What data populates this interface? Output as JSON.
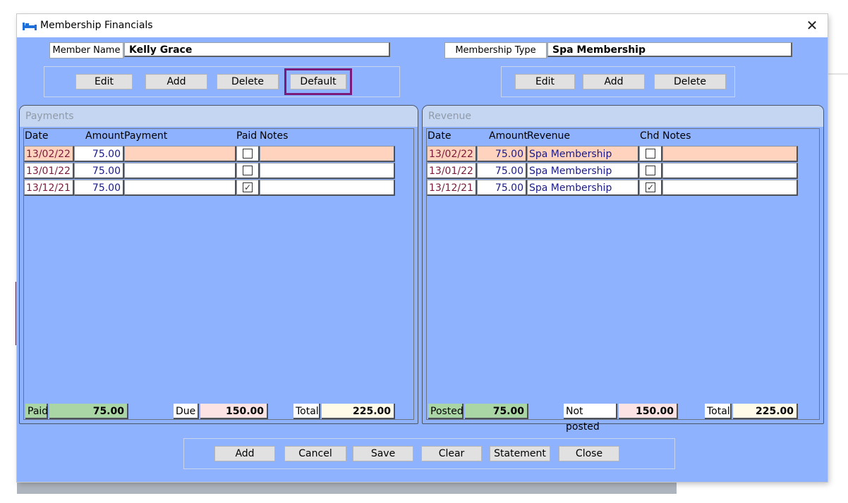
{
  "window": {
    "title": "Membership Financials",
    "close_glyph": "✕",
    "icon": "bed-icon"
  },
  "member": {
    "label": "Member Name",
    "value": "Kelly Grace"
  },
  "membership": {
    "label": "Membership Type",
    "value": "Spa Membership"
  },
  "left_buttons": {
    "edit": "Edit",
    "add": "Add",
    "delete": "Delete",
    "default": "Default"
  },
  "right_buttons": {
    "edit": "Edit",
    "add": "Add",
    "delete": "Delete"
  },
  "payments": {
    "title": "Payments",
    "columns": {
      "date": "Date",
      "amount": "Amount",
      "payment": "Payment",
      "paid": "Paid",
      "notes": "Notes"
    },
    "rows": [
      {
        "date": "13/02/22",
        "amount": "75.00",
        "payment": "",
        "paid": false,
        "notes": ""
      },
      {
        "date": "13/01/22",
        "amount": "75.00",
        "payment": "",
        "paid": false,
        "notes": ""
      },
      {
        "date": "13/12/21",
        "amount": "75.00",
        "payment": "",
        "paid": true,
        "notes": ""
      }
    ],
    "totals": {
      "paid_label": "Paid",
      "paid_value": "75.00",
      "due_label": "Due",
      "due_value": "150.00",
      "total_label": "Total",
      "total_value": "225.00"
    }
  },
  "revenue": {
    "title": "Revenue",
    "columns": {
      "date": "Date",
      "amount": "Amount",
      "revenue": "Revenue",
      "chd": "Chd",
      "notes": "Notes"
    },
    "rows": [
      {
        "date": "13/02/22",
        "amount": "75.00",
        "revenue": "Spa Membership",
        "chd": false,
        "notes": ""
      },
      {
        "date": "13/01/22",
        "amount": "75.00",
        "revenue": "Spa Membership",
        "chd": false,
        "notes": ""
      },
      {
        "date": "13/12/21",
        "amount": "75.00",
        "revenue": "Spa Membership",
        "chd": true,
        "notes": ""
      }
    ],
    "totals": {
      "posted_label": "Posted",
      "posted_value": "75.00",
      "notposted_label": "Not posted",
      "notposted_value": "150.00",
      "total_label": "Total",
      "total_value": "225.00"
    }
  },
  "bottom_buttons": {
    "add": "Add",
    "cancel": "Cancel",
    "save": "Save",
    "clear": "Clear",
    "statement": "Statement",
    "close": "Close"
  },
  "colors": {
    "window_bg": "#8fb2ff",
    "row_highlight": "#ffd3bd",
    "paid_green": "#a9d6a4",
    "due_pink": "#fde3e3",
    "highlight_outline": "#7a1a7a"
  }
}
